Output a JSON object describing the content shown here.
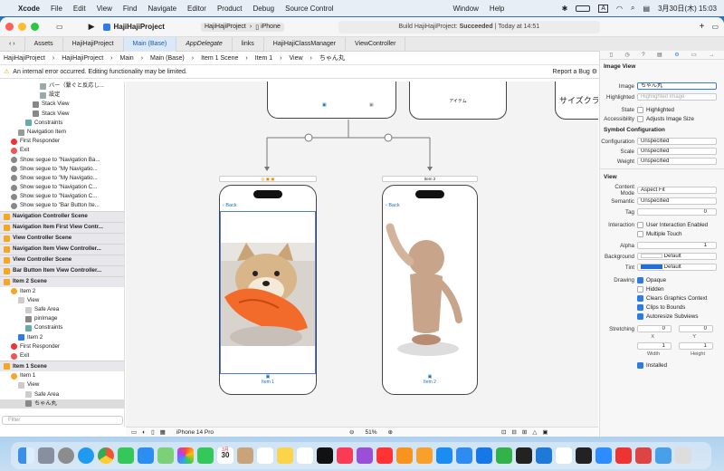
{
  "menubar": {
    "app": "Xcode",
    "menus": [
      "File",
      "Edit",
      "View",
      "Find",
      "Navigate",
      "Editor",
      "Product",
      "Debug",
      "Source Control"
    ],
    "right_menus": [
      "Window",
      "Help"
    ],
    "clock": "3月30日(木) 15:03"
  },
  "toolbar": {
    "project": "HajiHajiProject",
    "scheme": "HajiHajiProject",
    "device": "iPhone",
    "status_prefix": "Build HajiHajiProject: ",
    "status_result": "Succeeded",
    "status_time": " | Today at 14:51"
  },
  "tabs": [
    "Assets",
    "HajiHajiProject",
    "Main (Base)",
    "AppDelegate",
    "links",
    "HajiHajiClassManager",
    "ViewController"
  ],
  "breadcrumbs": [
    "HajiHajiProject",
    "HajiHajiProject",
    "Main",
    "Main (Base)",
    "Item 1 Scene",
    "Item 1",
    "View",
    "ちゃん丸"
  ],
  "warning": {
    "text": "An internal error occurred. Editing functionality may be limited.",
    "report": "Report a Bug"
  },
  "navigator": {
    "rows": [
      {
        "label": "バー（繋ぐと反応し...",
        "indent": 5,
        "kind": "item"
      },
      {
        "label": "設定",
        "indent": 5,
        "kind": "item"
      },
      {
        "label": "Stack View",
        "indent": 4,
        "kind": "stack"
      },
      {
        "label": "Stack View",
        "indent": 4,
        "kind": "stack"
      },
      {
        "label": "Constraints",
        "indent": 3,
        "kind": "constraint"
      },
      {
        "label": "Navigation Item",
        "indent": 2,
        "kind": "nav"
      },
      {
        "label": "First Responder",
        "indent": 1,
        "kind": "responder"
      },
      {
        "label": "Exit",
        "indent": 1,
        "kind": "exit"
      },
      {
        "label": "Show segue to \"Navigation Ba...",
        "indent": 1,
        "kind": "segue"
      },
      {
        "label": "Show segue to \"My Navigatio...",
        "indent": 1,
        "kind": "segue"
      },
      {
        "label": "Show segue to \"My Navigatio...",
        "indent": 1,
        "kind": "segue"
      },
      {
        "label": "Show segue to \"Navigation C...",
        "indent": 1,
        "kind": "segue"
      },
      {
        "label": "Show segue to \"Navigation C...",
        "indent": 1,
        "kind": "segue"
      },
      {
        "label": "Show segue to \"Bar Button Ite...",
        "indent": 1,
        "kind": "segue"
      },
      {
        "label": "Navigation Controller Scene",
        "indent": 0,
        "kind": "scene"
      },
      {
        "label": "Navigation Item First View Contr...",
        "indent": 0,
        "kind": "scene"
      },
      {
        "label": "View Controller Scene",
        "indent": 0,
        "kind": "scene"
      },
      {
        "label": "Navigation Item View Controller...",
        "indent": 0,
        "kind": "scene"
      },
      {
        "label": "View Controller Scene",
        "indent": 0,
        "kind": "scene"
      },
      {
        "label": "Bar Button Item View Controller...",
        "indent": 0,
        "kind": "scene"
      },
      {
        "label": "Item 2 Scene",
        "indent": 0,
        "kind": "scene"
      },
      {
        "label": "Item 2",
        "indent": 1,
        "kind": "vc"
      },
      {
        "label": "View",
        "indent": 2,
        "kind": "view"
      },
      {
        "label": "Safe Area",
        "indent": 3,
        "kind": "safe"
      },
      {
        "label": "pinImage",
        "indent": 3,
        "kind": "image"
      },
      {
        "label": "Constraints",
        "indent": 3,
        "kind": "constraint"
      },
      {
        "label": "Item 2",
        "indent": 2,
        "kind": "star"
      },
      {
        "label": "First Responder",
        "indent": 1,
        "kind": "responder"
      },
      {
        "label": "Exit",
        "indent": 1,
        "kind": "exit"
      },
      {
        "label": "Item 1 Scene",
        "indent": 0,
        "kind": "scene"
      },
      {
        "label": "Item 1",
        "indent": 1,
        "kind": "vc"
      },
      {
        "label": "View",
        "indent": 2,
        "kind": "view"
      },
      {
        "label": "Safe Area",
        "indent": 3,
        "kind": "safe"
      },
      {
        "label": "ちゃん丸",
        "indent": 3,
        "kind": "image",
        "selected": true
      }
    ],
    "filter_placeholder": "Filter"
  },
  "canvas": {
    "top_left_tag": "Item 1",
    "top_right_text": "アイテム",
    "top_right2_text": "サイズクラ",
    "left_phone_tab": "Item 1",
    "right_phone_tab": "Item 2",
    "back_label": "Back",
    "right_scene_tag": "Item 2"
  },
  "bottombar": {
    "device": "iPhone 14 Pro",
    "zoom": "51%"
  },
  "inspector": {
    "image_view_title": "Image View",
    "image_label": "Image",
    "image_value": "ちゃん丸",
    "highlighted_label": "Highlighted",
    "highlighted_placeholder": "Highlighted Image",
    "state_label": "State",
    "state_value": "Highlighted",
    "accessibility_label": "Accessibility",
    "accessibility_value": "Adjusts Image Size",
    "symbol_title": "Symbol Configuration",
    "configuration_label": "Configuration",
    "configuration_value": "Unspecified",
    "scale_label": "Scale",
    "scale_value": "Unspecified",
    "weight_label": "Weight",
    "weight_value": "Unspecified",
    "view_title": "View",
    "content_mode_label": "Content Mode",
    "content_mode_value": "Aspect Fit",
    "semantic_label": "Semantic",
    "semantic_value": "Unspecified",
    "tag_label": "Tag",
    "tag_value": "0",
    "interaction_label": "Interaction",
    "interaction_values": [
      "User Interaction Enabled",
      "Multiple Touch"
    ],
    "alpha_label": "Alpha",
    "alpha_value": "1",
    "background_label": "Background",
    "background_value": "Default",
    "tint_label": "Tint",
    "tint_value": "Default",
    "drawing_label": "Drawing",
    "drawing_values": [
      "Opaque",
      "Hidden",
      "Clears Graphics Context",
      "Clips to Bounds",
      "Autoresize Subviews"
    ],
    "drawing_checked": [
      true,
      false,
      true,
      true,
      true
    ],
    "stretching_label": "Stretching",
    "stretch_x": "0",
    "stretch_y": "0",
    "stretch_x_label": "X",
    "stretch_y_label": "Y",
    "stretch_w": "1",
    "stretch_h": "1",
    "width_label": "Width",
    "height_label": "Height",
    "installed_label": "Installed"
  },
  "colors": {
    "accent": "#2f7be6",
    "warning": "#e6a400",
    "tint_swatch": "#1f6fd8"
  },
  "dock": {
    "calendar_month": "3月",
    "calendar_day": "30"
  }
}
